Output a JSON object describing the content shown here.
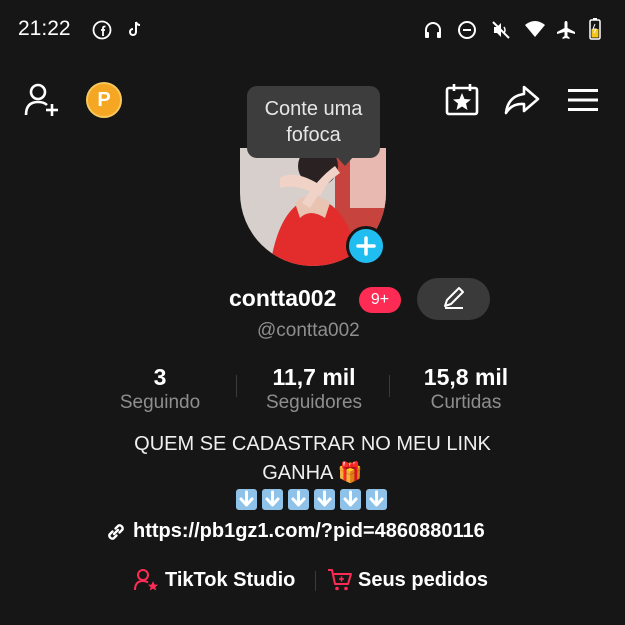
{
  "status_bar": {
    "time": "21:22",
    "icons": [
      "facebook-icon",
      "tiktok-icon",
      "headphones-icon",
      "dnd-icon",
      "mute-icon",
      "wifi-icon",
      "airplane-icon",
      "battery-icon"
    ]
  },
  "header": {
    "icons": [
      "add-friend-icon",
      "coin-icon",
      "calendar-star-icon",
      "share-icon",
      "menu-icon"
    ],
    "coin_letter": "P"
  },
  "tooltip": {
    "line1": "Conte uma",
    "line2": "fofoca"
  },
  "profile": {
    "username": "contta002",
    "badge": "9+",
    "handle": "@contta002"
  },
  "stats": [
    {
      "value": "3",
      "label": "Seguindo"
    },
    {
      "value": "11,7 mil",
      "label": "Seguidores"
    },
    {
      "value": "15,8 mil",
      "label": "Curtidas"
    }
  ],
  "bio": {
    "line1": "QUEM SE CADASTRAR NO MEU LINK",
    "line2": "GANHA 🎁",
    "arrows": 6
  },
  "link": "https://pb1gz1.com/?pid=4860880116",
  "bottom": {
    "studio": "TikTok Studio",
    "orders": "Seus pedidos"
  },
  "colors": {
    "accent": "#fe2c55",
    "plus": "#20bdf0",
    "coin": "#f5a623"
  }
}
